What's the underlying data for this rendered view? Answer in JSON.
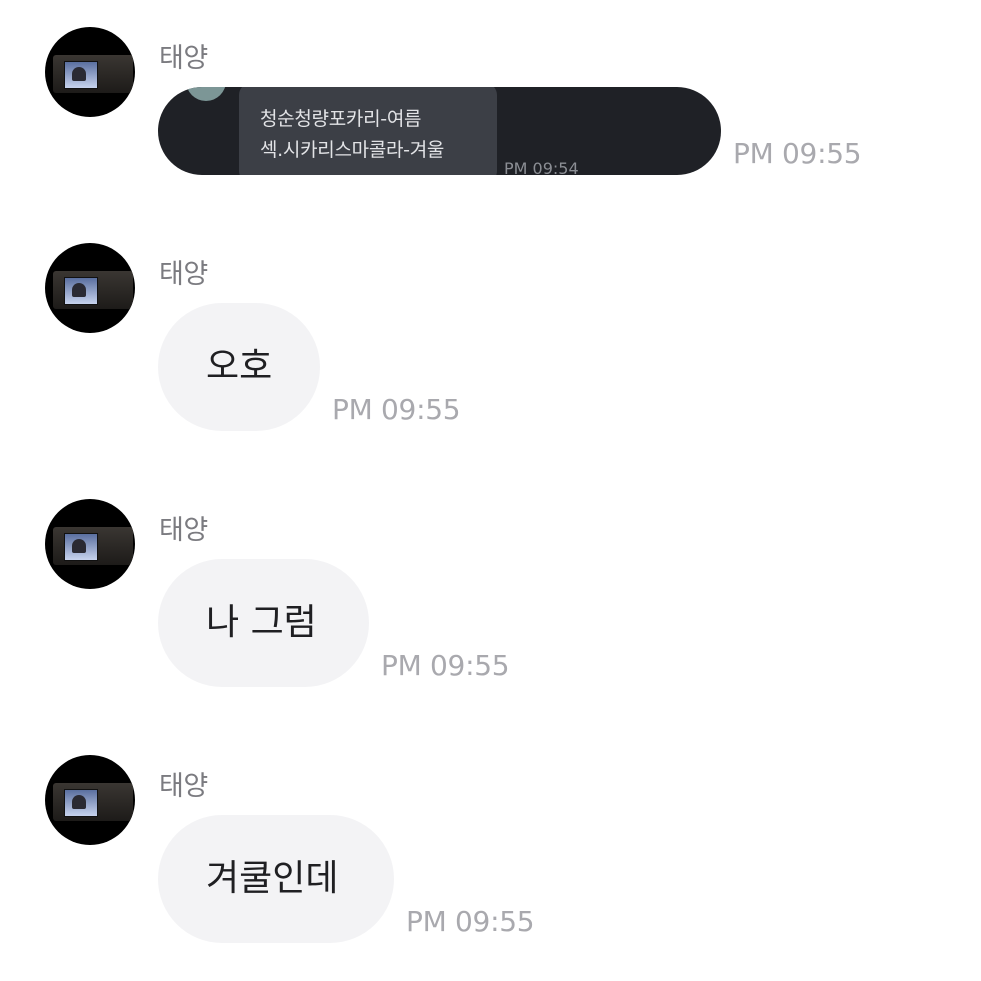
{
  "messages": [
    {
      "sender": "태양",
      "type": "image",
      "image_text": {
        "line1": "청순청량포카리-여름",
        "line2": "섹.시카리스마콜라-겨울",
        "time": "PM 09:54"
      },
      "time": "PM 09:55"
    },
    {
      "sender": "태양",
      "type": "text",
      "text": "오호",
      "time": "PM 09:55"
    },
    {
      "sender": "태양",
      "type": "text",
      "text": "나 그럼",
      "time": "PM 09:55"
    },
    {
      "sender": "태양",
      "type": "text",
      "text": "겨쿨인데",
      "time": "PM 09:55"
    }
  ],
  "colors": {
    "background": "#ffffff",
    "bubble": "#f3f3f5",
    "image_bubble": "#1f2126",
    "sender_text": "#7b7b80",
    "time_text": "#a9a9ae"
  }
}
